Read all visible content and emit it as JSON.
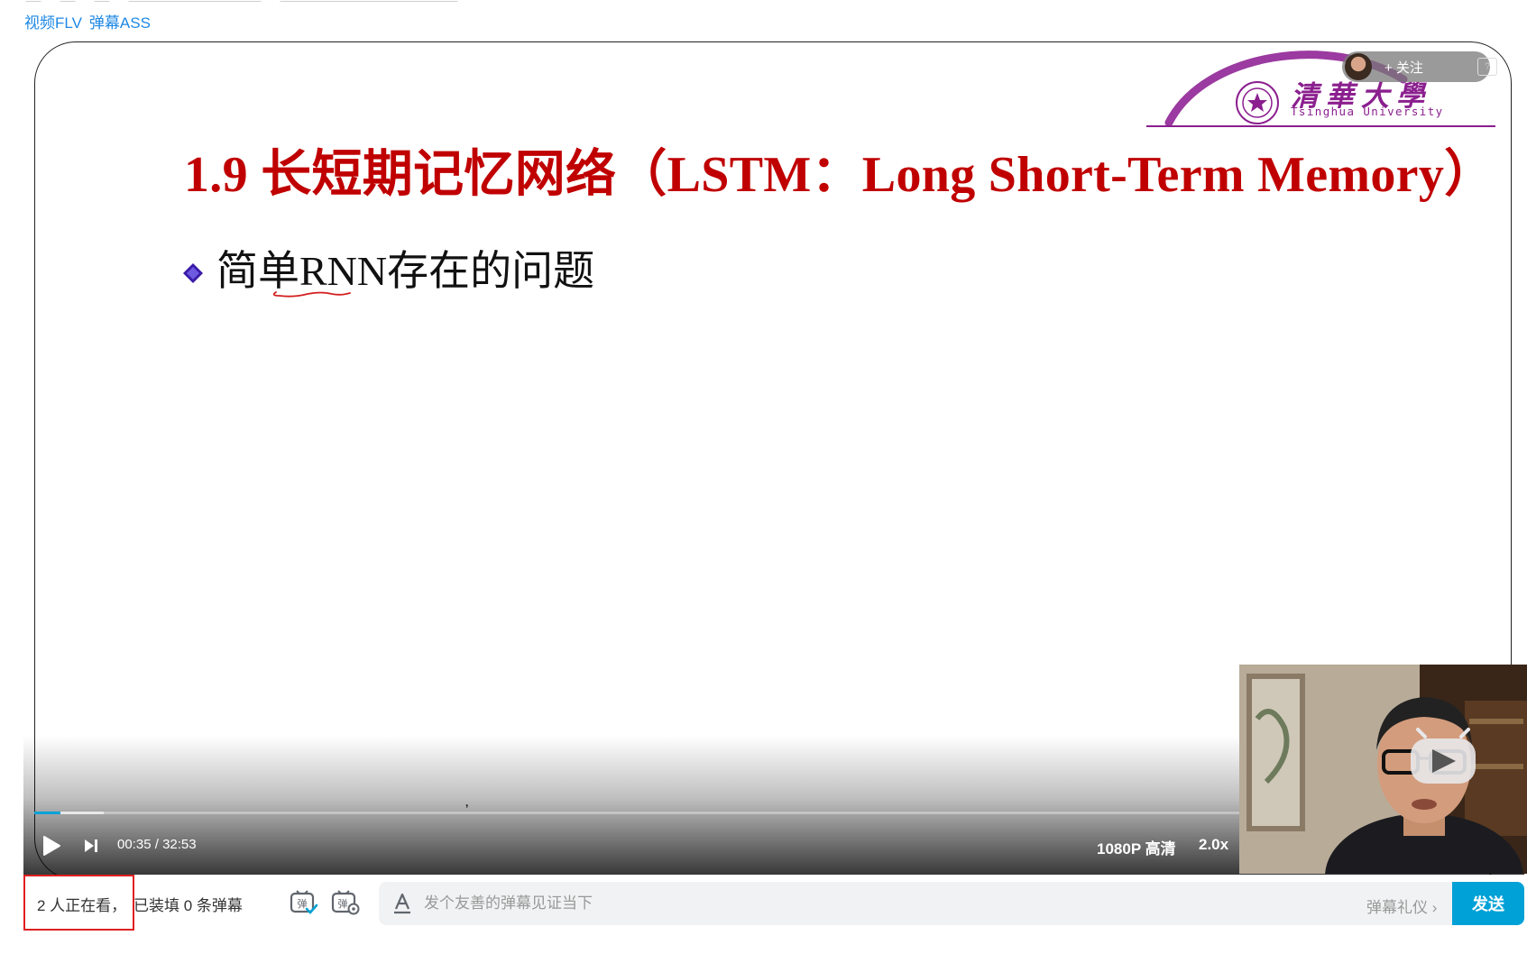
{
  "downloads": {
    "video_flv": "视频FLV",
    "danmaku_ass": "弹幕ASS"
  },
  "slide": {
    "title": "1.9 长短期记忆网络（LSTM：Long Short-Term Memory）",
    "bullet": "简单RNN存在的问题",
    "logo_cn": "清華大學",
    "logo_en": "Tsinghua University"
  },
  "uploader": {
    "follow_label": "+ 关注"
  },
  "player": {
    "current_time": "00:35",
    "separator": "/",
    "duration": "32:53",
    "progress_fraction": 0.018,
    "buffer_fraction": 0.047,
    "quality": "1080P 高清",
    "speed": "2.0x",
    "help": "?"
  },
  "danmaku": {
    "viewers": "2 人正在看，",
    "loaded": "已装填 0 条弹幕",
    "placeholder": "发个友善的弹幕见证当下",
    "etiquette": "弹幕礼仪 ›",
    "send": "发送"
  },
  "colors": {
    "accent": "#00a1d6",
    "slide_title": "#c00000",
    "logo_purple": "#8b1f8f",
    "highlight_box": "#e02020",
    "link": "#1e88e5"
  }
}
